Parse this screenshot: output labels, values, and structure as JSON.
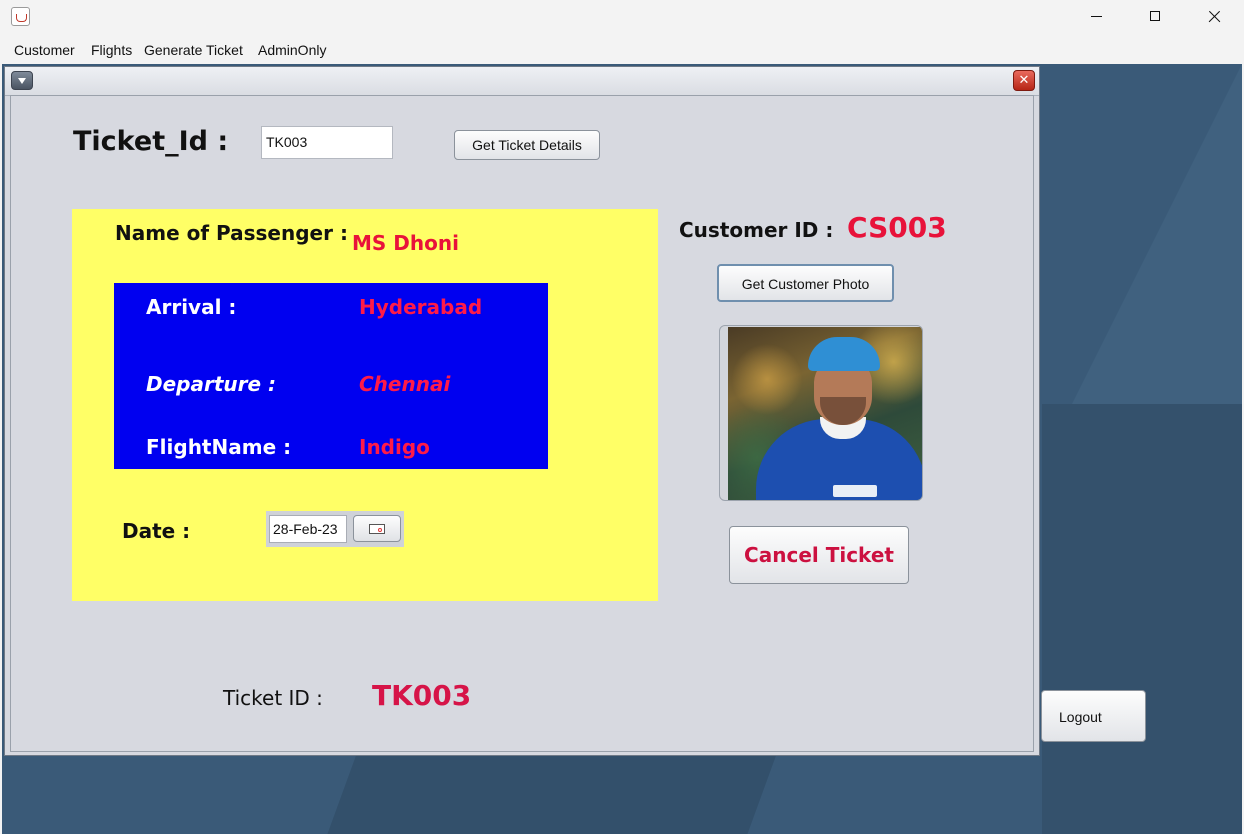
{
  "menubar": {
    "items": [
      "Customer",
      "Flights",
      "Generate Ticket",
      "AdminOnly"
    ]
  },
  "form": {
    "ticket_id_label": "Ticket_Id :",
    "ticket_id_value": "TK003",
    "get_details_button": "Get Ticket Details",
    "passenger_label": "Name of Passenger :",
    "passenger_value": "MS Dhoni",
    "arrival_label": "Arrival :",
    "arrival_value": "Hyderabad",
    "departure_label": "Departure :",
    "departure_value": "Chennai",
    "flight_label": "FlightName :",
    "flight_value": "Indigo",
    "date_label": "Date :",
    "date_value": "28-Feb-23",
    "customer_id_label": "Customer ID :",
    "customer_id_value": "CS003",
    "get_photo_button": "Get Customer Photo",
    "cancel_button": "Cancel Ticket",
    "footer_label": "Ticket ID :",
    "footer_value": "TK003"
  },
  "logout_button": "Logout",
  "icons": {
    "window_minimize": "minimize-icon",
    "window_maximize": "maximize-icon",
    "window_close": "close-icon",
    "frame_menu": "chevron-down-icon",
    "frame_close": "close-icon",
    "date_picker": "calendar-icon"
  },
  "colors": {
    "panel_yellow": "#ffff66",
    "panel_blue": "#0000f0",
    "accent_red": "#e8123a",
    "desktop": "#3a5a78"
  }
}
